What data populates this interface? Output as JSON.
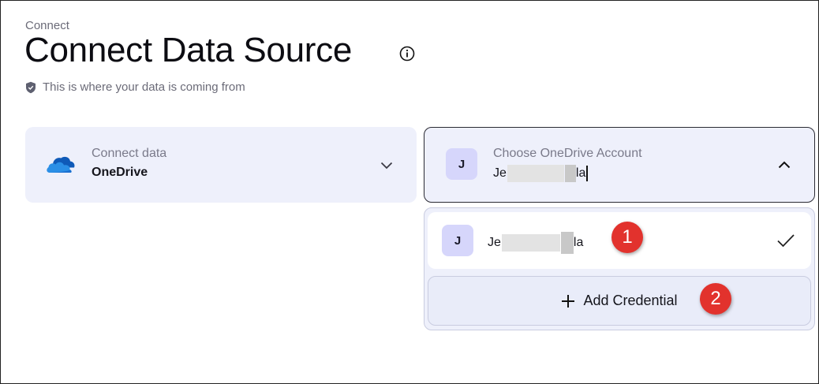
{
  "header": {
    "breadcrumb": "Connect",
    "title": "Connect Data Source",
    "info_icon": "info-circle-icon",
    "subtitle": "This is where your data is coming from",
    "subtitle_icon": "shield-icon"
  },
  "source_card": {
    "icon": "onedrive-cloud-icon",
    "label": "Connect data",
    "value": "OneDrive",
    "toggle_icon": "chevron-down-icon"
  },
  "account_card": {
    "avatar_initial": "J",
    "label": "Choose OneDrive Account",
    "value_prefix": "Je",
    "value_suffix": "la",
    "toggle_icon": "chevron-up-icon"
  },
  "dropdown": {
    "options": [
      {
        "avatar_initial": "J",
        "name_prefix": "Je",
        "name_suffix": "la",
        "selected": true
      }
    ],
    "add_label": "Add Credential",
    "add_icon": "plus-icon"
  },
  "annotations": [
    "1",
    "2"
  ],
  "colors": {
    "card_bg": "#eef0fb",
    "avatar_bg": "#d6d6fb",
    "marker_red": "#e2322d",
    "onedrive_blue": "#1a64c8"
  }
}
